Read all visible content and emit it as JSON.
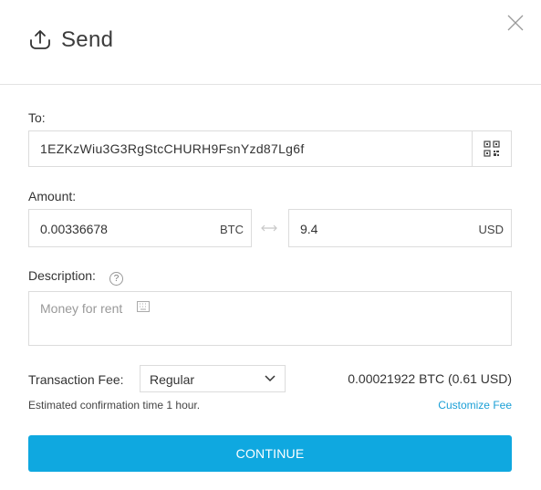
{
  "header": {
    "title": "Send"
  },
  "to": {
    "label": "To:",
    "address": "1EZKzWiu3G3RgStcCHURH9FsnYzd87Lg6f"
  },
  "amount": {
    "label": "Amount:",
    "crypto_value": "0.00336678",
    "crypto_unit": "BTC",
    "fiat_value": "9.4",
    "fiat_unit": "USD"
  },
  "description": {
    "label": "Description:",
    "help": "?",
    "placeholder": "Money for rent"
  },
  "fee": {
    "label": "Transaction Fee:",
    "selected": "Regular",
    "amount": "0.00021922 BTC (0.61 USD)",
    "estimate": "Estimated confirmation time 1 hour.",
    "customize_label": "Customize Fee"
  },
  "continue_label": "CONTINUE"
}
